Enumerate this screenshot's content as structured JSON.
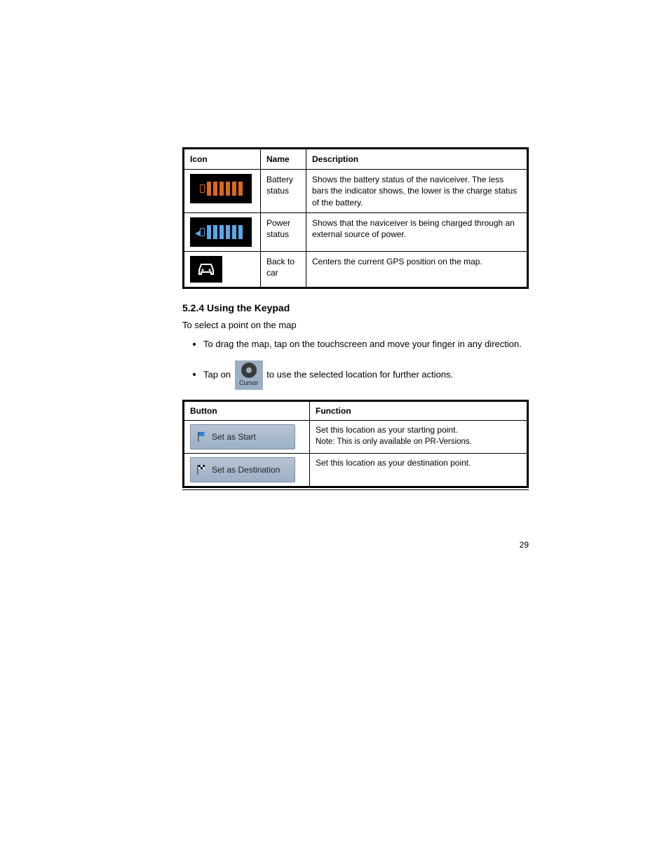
{
  "table1": {
    "headers": {
      "col1": "Icon",
      "col2": "Name",
      "col3": "Description"
    },
    "rows": [
      {
        "name": "Battery status",
        "desc": "Shows the battery status of the naviceiver. The less bars the indicator shows, the lower is the charge status of the battery."
      },
      {
        "name": "Power status",
        "desc": "Shows that the naviceiver is being charged through an external source of power."
      },
      {
        "name": "Back to car",
        "desc": "Centers the current GPS position on the map."
      }
    ]
  },
  "section": {
    "heading": "5.2.4 Using the Keypad",
    "intro": "To select a point on the map",
    "bullets": [
      "To drag the map, tap on the touchscreen and move your finger in any direction.",
      {
        "pre": "Tap on ",
        "iconLabel": "Cursor",
        "post": " to use the selected location for further actions."
      }
    ]
  },
  "table2": {
    "headers": {
      "col1": "Button",
      "col2": "Function"
    },
    "rows": [
      {
        "btnLabel": "Set as Start",
        "desc": "Set this location as your starting point.",
        "note": "Note: This is only available on PR-Versions."
      },
      {
        "btnLabel": "Set as Destination",
        "desc": "Set this location as your destination point."
      }
    ]
  },
  "pageNumber": "29"
}
